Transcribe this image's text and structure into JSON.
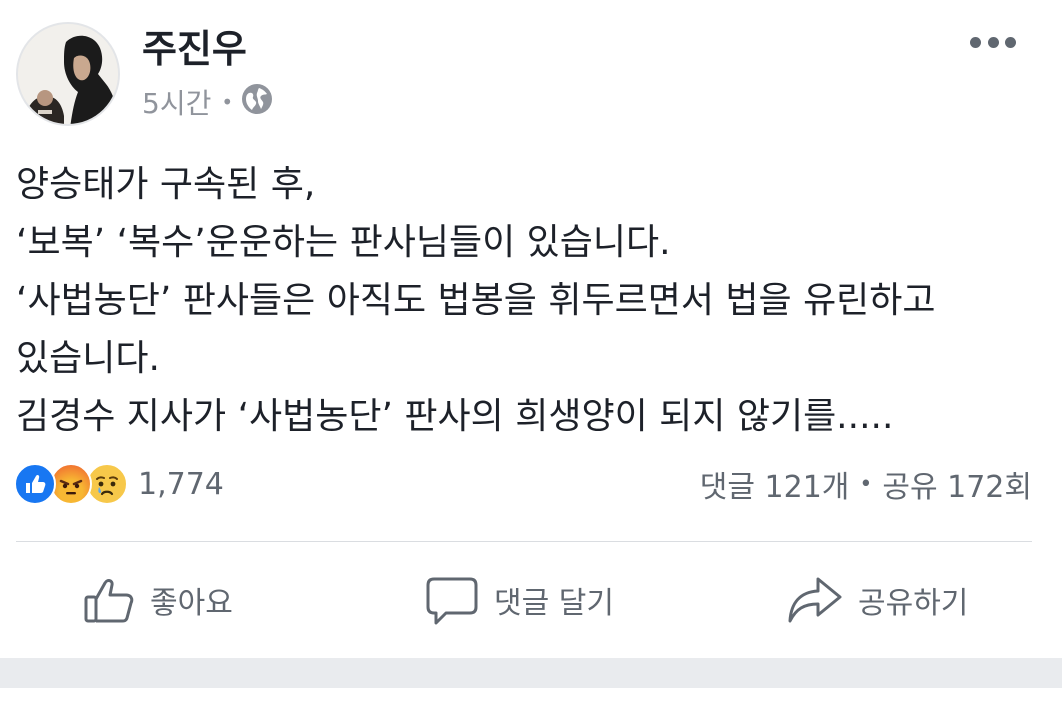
{
  "post": {
    "author": "주진우",
    "time": "5시간",
    "dot": "•",
    "privacy_icon": "globe-icon",
    "menu_icon": "more-dots-icon",
    "lines": [
      "양승태가 구속된 후,",
      "‘보복’ ‘복수’운운하는 판사님들이 있습니다.",
      "‘사법농단’ 판사들은 아직도 법봉을 휘두르면서 법을 유린하고",
      "있습니다.",
      "김경수 지사가 ‘사법농단’ 판사의 희생양이 되지 않기를....."
    ]
  },
  "reactions": {
    "types": [
      "like-icon",
      "angry-icon",
      "sad-icon"
    ],
    "count": "1,774"
  },
  "stats": {
    "comments": "댓글 121개",
    "sep": "•",
    "shares": "공유 172회"
  },
  "actions": {
    "like": "좋아요",
    "comment": "댓글 달기",
    "share": "공유하기"
  },
  "colors": {
    "text": "#1d2129",
    "secondary": "#606770",
    "meta": "#90949c",
    "like_blue": "#1877f2",
    "angry": "#f0633a",
    "sad": "#f7c232",
    "band": "#e9ebee"
  }
}
